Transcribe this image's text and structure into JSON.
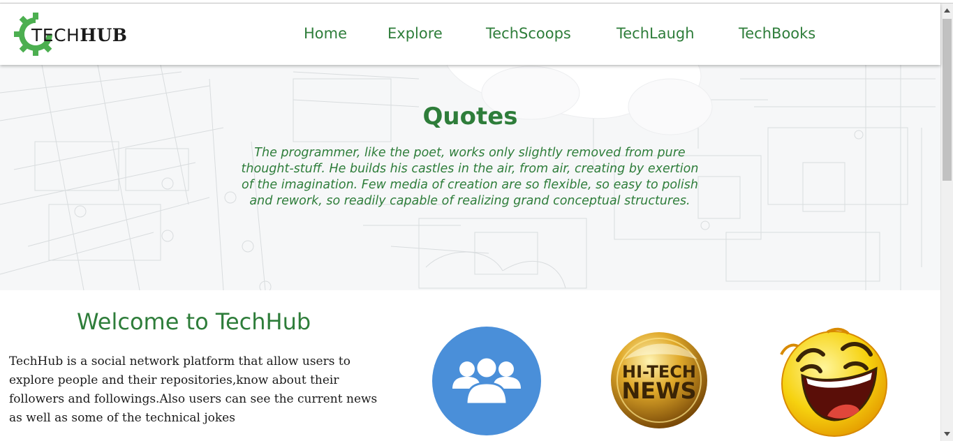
{
  "brand": {
    "logo_part1": "TECH",
    "logo_part2": "HUB",
    "colors": {
      "accent_green": "#2e7d3a",
      "gear_green": "#4caf50"
    }
  },
  "nav": {
    "items": [
      {
        "label": "Home"
      },
      {
        "label": "Explore"
      },
      {
        "label": "TechScoops"
      },
      {
        "label": "TechLaugh"
      },
      {
        "label": "TechBooks"
      }
    ]
  },
  "hero": {
    "title": "Quotes",
    "quote": "The programmer, like the poet, works only slightly removed from pure thought-stuff. He builds his castles in the air, from air, creating by exertion of the imagination. Few media of creation are so flexible, so easy to polish and rework, so readily capable of realizing grand conceptual structures."
  },
  "welcome": {
    "title": "Welcome to TechHub",
    "text": "TechHub is a social network platform that allow users to explore people and their repositories,know about their followers and followings.Also users can see the current news as well as some of the technical jokes"
  },
  "features": [
    {
      "icon": "people-group-icon",
      "color": "#4a8fd9"
    },
    {
      "icon": "hi-tech-news-badge",
      "line1": "HI-TECH",
      "line2": "NEWS"
    },
    {
      "icon": "laughing-emoji-icon",
      "color": "#f6d20f"
    }
  ]
}
